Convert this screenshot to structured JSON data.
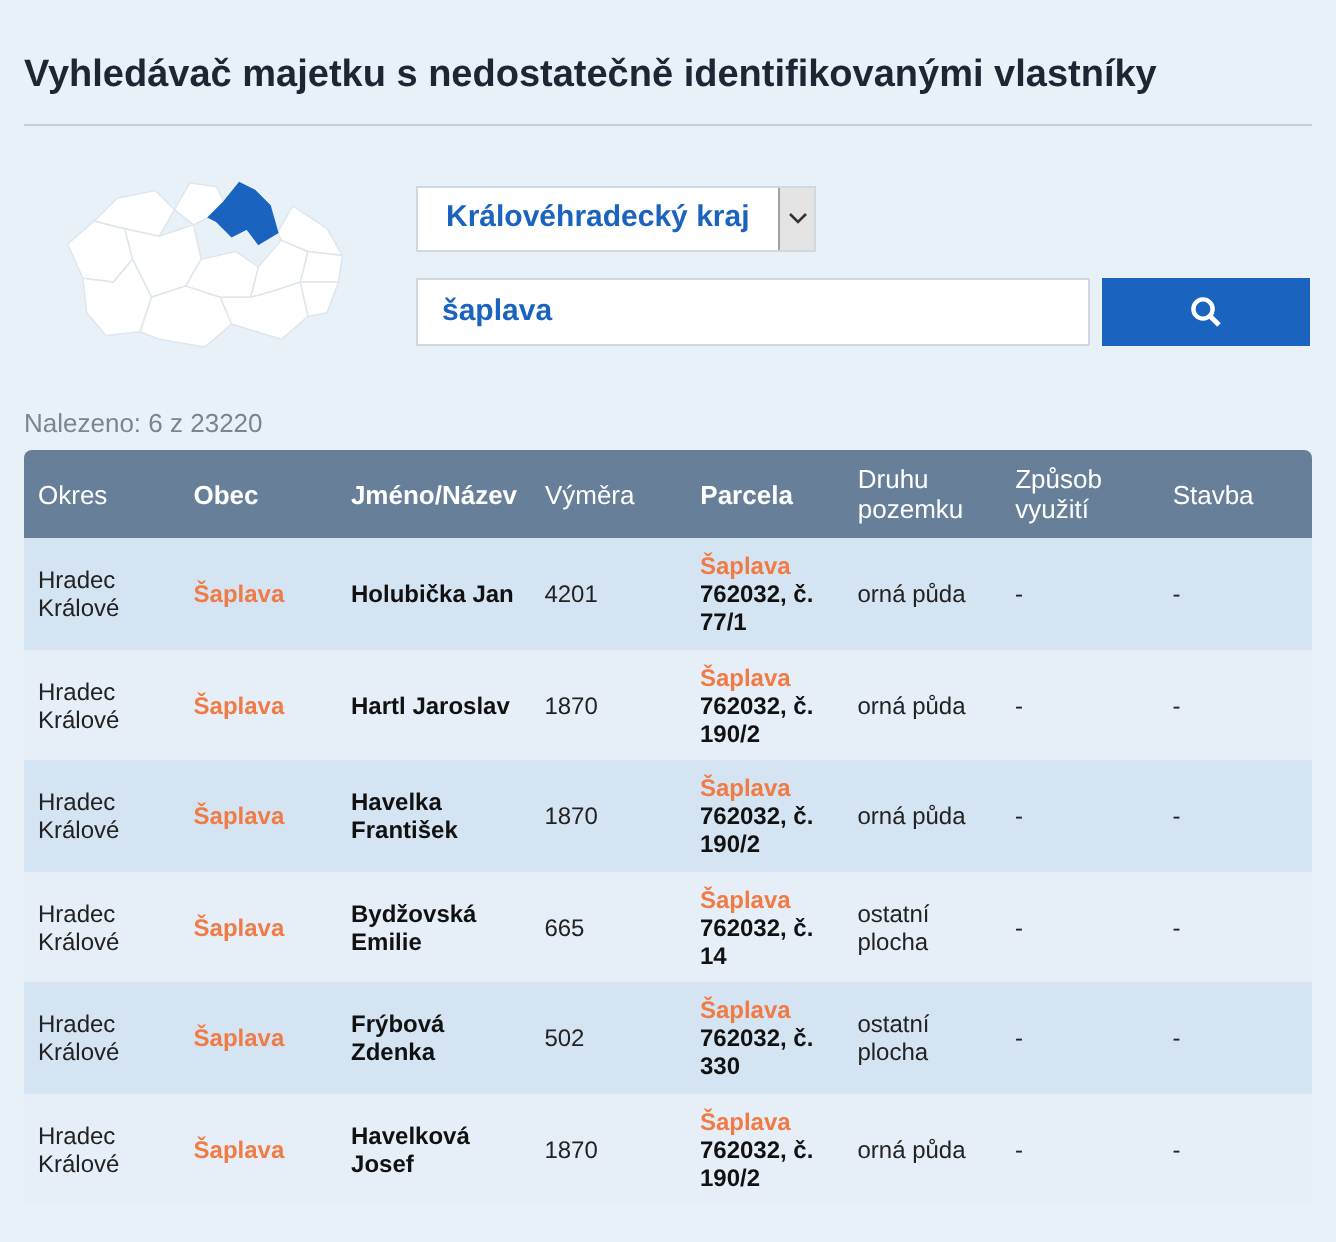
{
  "title": "Vyhledávač majetku s nedostatečně identifikovanými vlastníky",
  "region_select": {
    "value": "Královéhradecký kraj"
  },
  "search": {
    "value": "šaplava"
  },
  "result_count": "Nalezeno: 6 z 23220",
  "table": {
    "columns": [
      {
        "label": "Okres",
        "bold": false
      },
      {
        "label": "Obec",
        "bold": true
      },
      {
        "label": "Jméno/Název",
        "bold": true
      },
      {
        "label": "Výměra",
        "bold": false
      },
      {
        "label": "Parcela",
        "bold": true
      },
      {
        "label": "Druhu pozemku",
        "bold": false
      },
      {
        "label": "Způsob využití",
        "bold": false
      },
      {
        "label": "Stavba",
        "bold": false
      }
    ],
    "rows": [
      {
        "okres": "Hradec Králové",
        "obec": "Šaplava",
        "name": "Holubička Jan",
        "area": "4201",
        "parcel_town": "Šaplava",
        "parcel_number": "762032, č. 77/1",
        "land_type": "orná půda",
        "usage": "-",
        "building": "-"
      },
      {
        "okres": "Hradec Králové",
        "obec": "Šaplava",
        "name": "Hartl Jaroslav",
        "area": "1870",
        "parcel_town": "Šaplava",
        "parcel_number": "762032, č. 190/2",
        "land_type": "orná půda",
        "usage": "-",
        "building": "-"
      },
      {
        "okres": "Hradec Králové",
        "obec": "Šaplava",
        "name": "Havelka František",
        "area": "1870",
        "parcel_town": "Šaplava",
        "parcel_number": "762032, č. 190/2",
        "land_type": "orná půda",
        "usage": "-",
        "building": "-"
      },
      {
        "okres": "Hradec Králové",
        "obec": "Šaplava",
        "name": "Bydžovská Emilie",
        "area": "665",
        "parcel_town": "Šaplava",
        "parcel_number": "762032, č. 14",
        "land_type": "ostatní plocha",
        "usage": "-",
        "building": "-"
      },
      {
        "okres": "Hradec Králové",
        "obec": "Šaplava",
        "name": "Frýbová Zdenka",
        "area": "502",
        "parcel_town": "Šaplava",
        "parcel_number": "762032, č. 330",
        "land_type": "ostatní plocha",
        "usage": "-",
        "building": "-"
      },
      {
        "okres": "Hradec Králové",
        "obec": "Šaplava",
        "name": "Havelková Josef",
        "area": "1870",
        "parcel_town": "Šaplava",
        "parcel_number": "762032, č. 190/2",
        "land_type": "orná půda",
        "usage": "-",
        "building": "-"
      }
    ]
  }
}
